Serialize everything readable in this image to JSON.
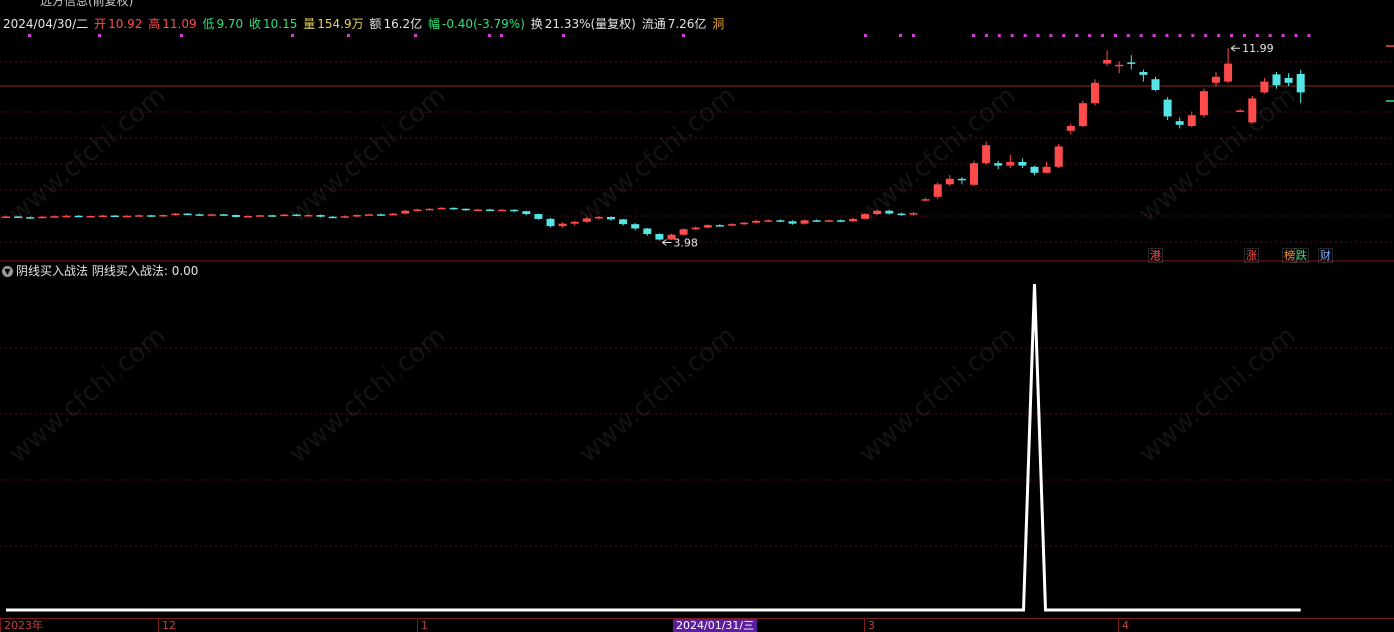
{
  "header": {
    "title_partial": "远方信息(前复权)",
    "date": "2024/04/30/二",
    "open_label": "开",
    "open": "10.92",
    "high_label": "高",
    "high": "11.09",
    "low_label": "低",
    "low": "9.70",
    "close_label": "收",
    "close": "10.15",
    "volume_label": "量",
    "volume": "154.9万",
    "amount_label": "额",
    "amount": "16.2亿",
    "change_label": "幅",
    "change": "-0.40(-3.79%)",
    "turnover_label": "换",
    "turnover": "21.33%(量复权)",
    "float_label": "流通",
    "float": "7.26亿",
    "extra": "洞"
  },
  "price_labels": {
    "max": "11.99",
    "min": "3.98"
  },
  "event_tags": [
    {
      "text": "港",
      "color": "#ff4b4b"
    },
    {
      "text": "涨",
      "color": "#ff4b4b"
    },
    {
      "text": "榜",
      "color": "#ff9a3a"
    },
    {
      "text": "跌",
      "color": "#2ee07a"
    },
    {
      "text": "财",
      "color": "#7fb0ff"
    }
  ],
  "indicator": {
    "icon": "chevron-down-icon",
    "name": "阴线买入战法",
    "value_text": "阴线买入战法: 0.00"
  },
  "axis": {
    "ticks": [
      "2023年",
      "12",
      "1",
      "3",
      "4"
    ],
    "highlight": "2024/01/31/三"
  },
  "watermark": "www.cfchi.com",
  "colors": {
    "up": "#ff4b4b",
    "down": "#54e6e6",
    "grid": "#5a0a0a",
    "signal": "#ffffff"
  },
  "chart_data": {
    "type": "candlestick",
    "ylim": [
      3.5,
      12.5
    ],
    "max_label_value": 11.99,
    "min_label_value": 3.98,
    "candles": [
      [
        4.95,
        4.98,
        5.02,
        4.9
      ],
      [
        4.98,
        4.95,
        5.0,
        4.92
      ],
      [
        4.95,
        4.94,
        4.98,
        4.9
      ],
      [
        4.94,
        4.97,
        5.0,
        4.91
      ],
      [
        4.97,
        4.99,
        5.03,
        4.95
      ],
      [
        4.99,
        5.01,
        5.05,
        4.96
      ],
      [
        5.01,
        4.98,
        5.04,
        4.95
      ],
      [
        4.98,
        5.0,
        5.02,
        4.95
      ],
      [
        5.0,
        5.02,
        5.05,
        4.97
      ],
      [
        5.02,
        5.0,
        5.04,
        4.98
      ],
      [
        5.0,
        5.01,
        5.03,
        4.97
      ],
      [
        5.01,
        5.03,
        5.06,
        4.99
      ],
      [
        5.03,
        4.99,
        5.05,
        4.97
      ],
      [
        4.99,
        5.04,
        5.07,
        4.97
      ],
      [
        5.04,
        5.1,
        5.13,
        5.02
      ],
      [
        5.1,
        5.07,
        5.12,
        5.04
      ],
      [
        5.07,
        5.05,
        5.1,
        5.02
      ],
      [
        5.05,
        5.07,
        5.1,
        5.03
      ],
      [
        5.07,
        5.04,
        5.09,
        5.01
      ],
      [
        5.04,
        4.96,
        5.06,
        4.94
      ],
      [
        4.96,
        5.0,
        5.03,
        4.93
      ],
      [
        5.0,
        5.03,
        5.05,
        4.98
      ],
      [
        5.03,
        5.0,
        5.05,
        4.97
      ],
      [
        5.0,
        5.06,
        5.08,
        4.98
      ],
      [
        5.06,
        5.02,
        5.09,
        5.0
      ],
      [
        5.02,
        5.04,
        5.07,
        5.0
      ],
      [
        5.04,
        4.97,
        5.06,
        4.94
      ],
      [
        4.97,
        4.95,
        5.0,
        4.92
      ],
      [
        4.95,
        4.99,
        5.02,
        4.92
      ],
      [
        4.99,
        5.04,
        5.07,
        4.96
      ],
      [
        5.04,
        5.07,
        5.1,
        5.02
      ],
      [
        5.07,
        5.03,
        5.1,
        5.01
      ],
      [
        5.03,
        5.1,
        5.13,
        5.01
      ],
      [
        5.1,
        5.22,
        5.25,
        5.08
      ],
      [
        5.22,
        5.27,
        5.3,
        5.19
      ],
      [
        5.27,
        5.3,
        5.33,
        5.24
      ],
      [
        5.3,
        5.34,
        5.37,
        5.28
      ],
      [
        5.34,
        5.3,
        5.36,
        5.26
      ],
      [
        5.3,
        5.25,
        5.32,
        5.22
      ],
      [
        5.25,
        5.27,
        5.3,
        5.22
      ],
      [
        5.27,
        5.24,
        5.3,
        5.21
      ],
      [
        5.24,
        5.26,
        5.29,
        5.21
      ],
      [
        5.26,
        5.2,
        5.28,
        5.16
      ],
      [
        5.2,
        5.08,
        5.22,
        5.04
      ],
      [
        5.08,
        4.88,
        5.1,
        4.84
      ],
      [
        4.88,
        4.58,
        4.92,
        4.52
      ],
      [
        4.58,
        4.68,
        4.74,
        4.5
      ],
      [
        4.68,
        4.76,
        4.8,
        4.6
      ],
      [
        4.76,
        4.9,
        4.95,
        4.72
      ],
      [
        4.9,
        4.96,
        5.0,
        4.85
      ],
      [
        4.96,
        4.86,
        4.98,
        4.8
      ],
      [
        4.86,
        4.66,
        4.88,
        4.6
      ],
      [
        4.66,
        4.48,
        4.7,
        4.4
      ],
      [
        4.48,
        4.25,
        4.5,
        4.18
      ],
      [
        4.25,
        4.02,
        4.28,
        3.98
      ],
      [
        4.02,
        4.22,
        4.26,
        4.0
      ],
      [
        4.22,
        4.45,
        4.48,
        4.2
      ],
      [
        4.45,
        4.52,
        4.56,
        4.42
      ],
      [
        4.52,
        4.62,
        4.65,
        4.48
      ],
      [
        4.62,
        4.6,
        4.66,
        4.56
      ],
      [
        4.6,
        4.66,
        4.7,
        4.56
      ],
      [
        4.66,
        4.72,
        4.76,
        4.62
      ],
      [
        4.72,
        4.8,
        4.84,
        4.68
      ],
      [
        4.8,
        4.82,
        4.86,
        4.76
      ],
      [
        4.82,
        4.78,
        4.86,
        4.74
      ],
      [
        4.78,
        4.68,
        4.82,
        4.64
      ],
      [
        4.68,
        4.82,
        4.86,
        4.64
      ],
      [
        4.82,
        4.8,
        4.86,
        4.76
      ],
      [
        4.8,
        4.82,
        4.85,
        4.76
      ],
      [
        4.82,
        4.78,
        4.86,
        4.74
      ],
      [
        4.78,
        4.88,
        4.92,
        4.74
      ],
      [
        4.88,
        5.08,
        5.12,
        4.86
      ],
      [
        5.08,
        5.22,
        5.26,
        5.04
      ],
      [
        5.22,
        5.1,
        5.26,
        5.06
      ],
      [
        5.1,
        5.06,
        5.14,
        5.02
      ],
      [
        5.06,
        5.12,
        5.16,
        5.02
      ],
      [
        5.7,
        5.7,
        5.76,
        5.64
      ],
      [
        5.8,
        6.32,
        6.4,
        5.7
      ],
      [
        6.32,
        6.55,
        6.7,
        6.25
      ],
      [
        6.55,
        6.5,
        6.62,
        6.32
      ],
      [
        6.3,
        7.2,
        7.3,
        6.25
      ],
      [
        7.2,
        7.95,
        8.1,
        7.15
      ],
      [
        7.2,
        7.1,
        7.3,
        6.95
      ],
      [
        7.1,
        7.25,
        7.55,
        7.0
      ],
      [
        7.25,
        7.1,
        7.4,
        7.0
      ],
      [
        7.05,
        6.8,
        7.1,
        6.7
      ],
      [
        6.8,
        7.05,
        7.25,
        6.78
      ],
      [
        7.05,
        7.9,
        8.0,
        7.0
      ],
      [
        8.55,
        8.75,
        8.85,
        8.4
      ],
      [
        8.75,
        9.7,
        9.8,
        8.7
      ],
      [
        9.7,
        10.55,
        10.7,
        9.6
      ],
      [
        11.35,
        11.5,
        11.9,
        11.25
      ],
      [
        11.3,
        11.3,
        11.45,
        10.95
      ],
      [
        11.4,
        11.35,
        11.7,
        11.1
      ],
      [
        11.0,
        10.88,
        11.1,
        10.6
      ],
      [
        10.7,
        10.25,
        10.8,
        10.2
      ],
      [
        9.85,
        9.15,
        9.95,
        9.0
      ],
      [
        8.95,
        8.8,
        9.1,
        8.65
      ],
      [
        8.75,
        9.2,
        9.35,
        8.7
      ],
      [
        9.2,
        10.2,
        10.3,
        9.1
      ],
      [
        10.55,
        10.8,
        11.0,
        10.4
      ],
      [
        10.6,
        11.35,
        11.99,
        10.55
      ],
      [
        9.4,
        9.4,
        9.45,
        9.35
      ],
      [
        8.9,
        9.9,
        10.0,
        8.85
      ],
      [
        10.15,
        10.6,
        10.75,
        10.1
      ],
      [
        10.9,
        10.45,
        11.0,
        10.3
      ],
      [
        10.75,
        10.55,
        10.95,
        10.4
      ],
      [
        10.92,
        10.15,
        11.09,
        9.7
      ]
    ],
    "indicator_series": {
      "name": "阴线买入战法",
      "baseline": 0,
      "spike_value": 1,
      "spike_index": 85
    }
  }
}
